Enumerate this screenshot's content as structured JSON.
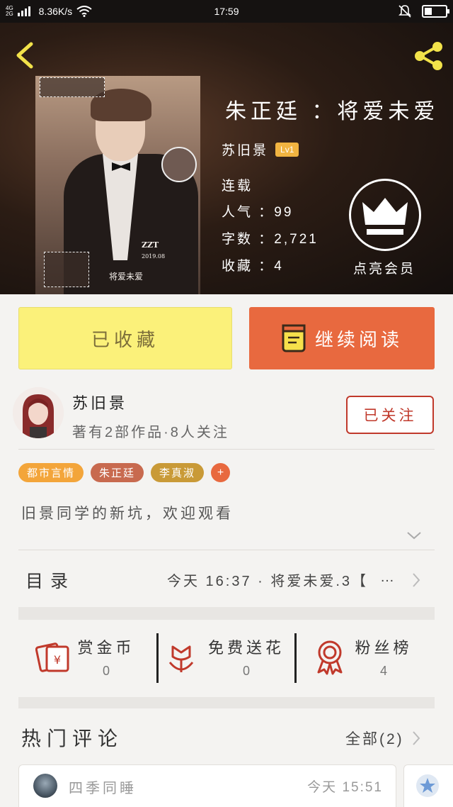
{
  "status_bar": {
    "network_top": "4G",
    "network_bottom": "2G",
    "speed": "8.36K/s",
    "time": "17:59",
    "icons": [
      "signal-icon",
      "wifi-icon",
      "bell-muted-icon",
      "battery-icon"
    ]
  },
  "book": {
    "title": "朱正廷 ：将爱未爱",
    "author": "苏旧景",
    "level": "Lv1",
    "status": "连载",
    "popularity": "人气 ：99",
    "word_count": "字数 ：2,721",
    "favorites": "收藏 ：4",
    "vip_label": "点亮会员"
  },
  "cover": {
    "tag": "ZZT",
    "date": "2019.08",
    "caption": "将爱未爱"
  },
  "actions": {
    "collected_label": "已收藏",
    "read_label": "继续阅读"
  },
  "author_card": {
    "name": "苏旧景",
    "subtitle": "著有2部作品·8人关注",
    "follow_label": "已关注"
  },
  "tags": [
    {
      "label": "都市言情",
      "color": "#f3a53a"
    },
    {
      "label": "朱正廷",
      "color": "#c86a4f"
    },
    {
      "label": "李真淑",
      "color": "#c99a37"
    }
  ],
  "tag_add": "+",
  "description": "旧景同学的新坑，欢迎观看",
  "toc": {
    "label": "目录",
    "latest": "今天 16:37 · 将爱未爱.3【",
    "more": "…"
  },
  "stats": [
    {
      "label": "赏金币",
      "value": "0",
      "icon": "red-envelope-icon"
    },
    {
      "label": "免费送花",
      "value": "0",
      "icon": "flower-icon"
    },
    {
      "label": "粉丝榜",
      "value": "4",
      "icon": "medal-icon"
    }
  ],
  "hot_comments": {
    "title": "热门评论",
    "all_label": "全部(2)"
  },
  "comments": [
    {
      "name": "四季同睡",
      "time": "今天 15:51"
    }
  ],
  "colors": {
    "accent_orange": "#e8693f",
    "accent_red": "#c0392b",
    "collected_yellow": "#fbf17a",
    "level_badge": "#f1b441"
  }
}
